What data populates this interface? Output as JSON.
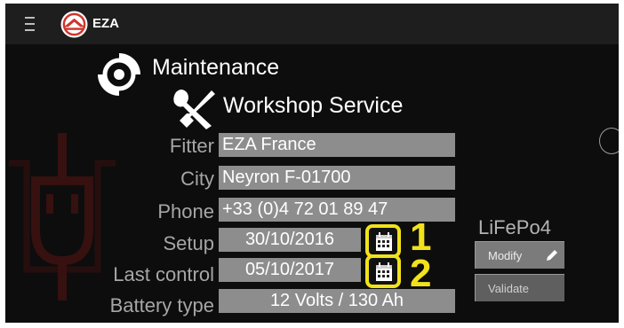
{
  "app": {
    "title": "EZA",
    "menu_icon": "hamburger-menu-icon",
    "logo_icon": "eza-logo-icon"
  },
  "sections": {
    "maintenance_title": "Maintenance",
    "maintenance_icon": "sync-gear-icon",
    "workshop_title": "Workshop Service",
    "workshop_icon": "tools-icon"
  },
  "form": {
    "fitter": {
      "label": "Fitter",
      "value": "EZA France"
    },
    "city": {
      "label": "City",
      "value": "Neyron F-01700"
    },
    "phone": {
      "label": "Phone",
      "value": "+33 (0)4 72 01 89 47"
    },
    "setup": {
      "label": "Setup",
      "value": "30/10/2016"
    },
    "last_control": {
      "label": "Last control",
      "value": "05/10/2017"
    },
    "battery_type": {
      "label": "Battery type",
      "value": "12 Volts / 130 Ah"
    }
  },
  "annotations": {
    "setup_number": "1",
    "last_control_number": "2",
    "highlight_color": "#f1e21c"
  },
  "battery": {
    "chemistry": "LiFePo4",
    "modify_label": "Modify",
    "validate_label": "Validate"
  },
  "colors": {
    "background": "#0d0d0d",
    "topbar": "#1e1e1e",
    "field": "#8d8d8d",
    "label": "#a6a6a6",
    "brand_red": "#d0342c"
  }
}
